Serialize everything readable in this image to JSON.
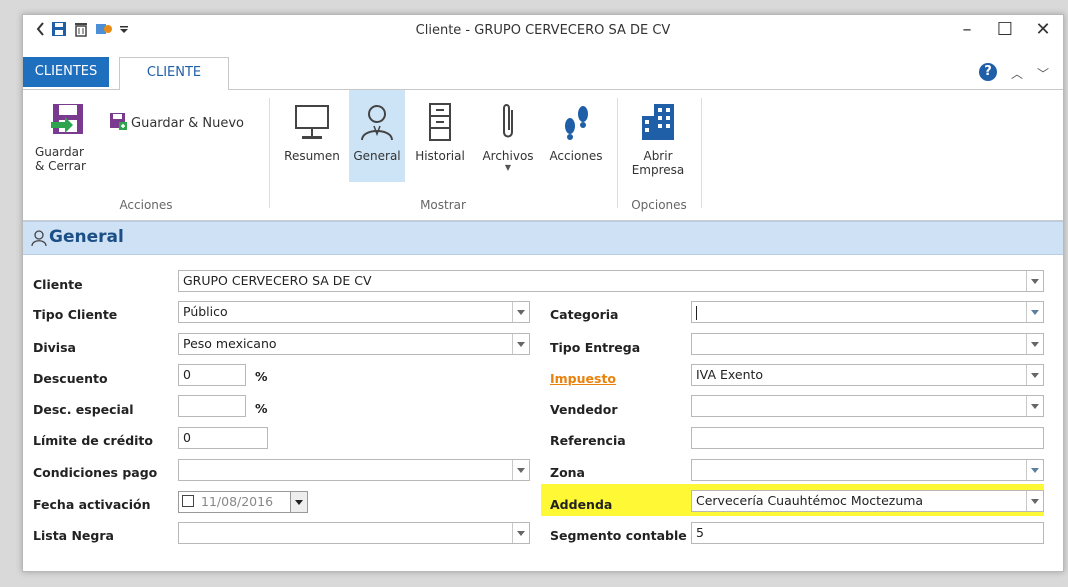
{
  "window": {
    "title": "Cliente - GRUPO CERVECERO SA DE CV"
  },
  "tabs": [
    {
      "label": "CLIENTES"
    },
    {
      "label": "CLIENTE"
    }
  ],
  "help_label": "?",
  "ribbon": {
    "acciones": {
      "guardar_cerrar": "Guardar\n& Cerrar",
      "guardar_nuevo": "Guardar & Nuevo",
      "group_label": "Acciones"
    },
    "mostrar": {
      "items": [
        "Resumen",
        "General",
        "Historial",
        "Archivos",
        "Acciones"
      ],
      "selected": "General",
      "group_label": "Mostrar"
    },
    "opciones": {
      "abrir_empresa": "Abrir\nEmpresa",
      "group_label": "Opciones"
    }
  },
  "section": {
    "title": "General"
  },
  "form": {
    "cliente": {
      "label": "Cliente",
      "value": "GRUPO CERVECERO SA DE CV"
    },
    "tipo_cliente": {
      "label": "Tipo Cliente",
      "value": "Público"
    },
    "divisa": {
      "label": "Divisa",
      "value": "Peso mexicano"
    },
    "descuento": {
      "label": "Descuento",
      "value": "0",
      "unit": "%"
    },
    "desc_especial": {
      "label": "Desc. especial",
      "value": "",
      "unit": "%"
    },
    "limite_credito": {
      "label": "Límite de crédito",
      "value": "0"
    },
    "condiciones_pago": {
      "label": "Condiciones pago",
      "value": ""
    },
    "fecha_activacion": {
      "label": "Fecha activación",
      "value": "11/08/2016"
    },
    "lista_negra": {
      "label": "Lista Negra",
      "value": ""
    },
    "categoria": {
      "label": "Categoria",
      "value": ""
    },
    "tipo_entrega": {
      "label": "Tipo Entrega",
      "value": ""
    },
    "impuesto": {
      "label": "Impuesto",
      "value": "IVA Exento"
    },
    "vendedor": {
      "label": "Vendedor",
      "value": ""
    },
    "referencia": {
      "label": "Referencia",
      "value": ""
    },
    "zona": {
      "label": "Zona",
      "value": ""
    },
    "addenda": {
      "label": "Addenda",
      "value": "Cervecería Cuauhtémoc Moctezuma"
    },
    "segmento_contable": {
      "label": "Segmento contable",
      "value": "5"
    }
  },
  "colors": {
    "accent": "#1f6fbf",
    "section_bg": "#cfe2f5",
    "highlight": "#fff834",
    "link": "#e8820d"
  }
}
